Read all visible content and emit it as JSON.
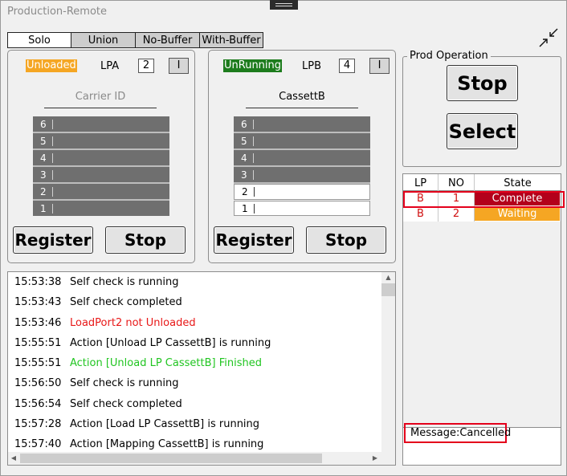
{
  "window": {
    "title": "Production-Remote"
  },
  "tabs": [
    "Solo",
    "Union",
    "No-Buffer",
    "With-Buffer"
  ],
  "icons": {
    "collapse": "collapse-arrows-icon"
  },
  "loadports": [
    {
      "status": "Unloaded",
      "status_color": "#f5a623",
      "name": "LPA",
      "count": "2",
      "i_label": "I",
      "carrier_label": "Carrier ID",
      "slots": [
        {
          "num": "6",
          "state": "dark"
        },
        {
          "num": "5",
          "state": "dark"
        },
        {
          "num": "4",
          "state": "dark"
        },
        {
          "num": "3",
          "state": "dark"
        },
        {
          "num": "2",
          "state": "dark"
        },
        {
          "num": "1",
          "state": "dark"
        }
      ],
      "register_label": "Register",
      "stop_label": "Stop"
    },
    {
      "status": "UnRunning",
      "status_color": "#1d7c1d",
      "name": "LPB",
      "count": "4",
      "i_label": "I",
      "carrier_label": "CassettB",
      "slots": [
        {
          "num": "6",
          "state": "dark"
        },
        {
          "num": "5",
          "state": "dark"
        },
        {
          "num": "4",
          "state": "dark"
        },
        {
          "num": "3",
          "state": "dark"
        },
        {
          "num": "2",
          "state": "light"
        },
        {
          "num": "1",
          "state": "light"
        }
      ],
      "register_label": "Register",
      "stop_label": "Stop"
    }
  ],
  "log": [
    {
      "time": "15:53:38",
      "msg": "Self check is running",
      "color": "black"
    },
    {
      "time": "15:53:43",
      "msg": "Self check completed",
      "color": "black"
    },
    {
      "time": "15:53:46",
      "msg": "LoadPort2 not Unloaded",
      "color": "red"
    },
    {
      "time": "15:55:51",
      "msg": "Action [Unload LP CassettB] is running",
      "color": "black"
    },
    {
      "time": "15:55:51",
      "msg": "Action [Unload LP CassettB] Finished",
      "color": "green"
    },
    {
      "time": "15:56:50",
      "msg": "Self check is running",
      "color": "black"
    },
    {
      "time": "15:56:54",
      "msg": "Self check completed",
      "color": "black"
    },
    {
      "time": "15:57:28",
      "msg": "Action [Load LP CassettB] is running",
      "color": "black"
    },
    {
      "time": "15:57:40",
      "msg": "Action [Mapping CassettB] is running",
      "color": "black"
    }
  ],
  "prod_operation": {
    "legend": "Prod Operation",
    "stop_label": "Stop",
    "select_label": "Select"
  },
  "job_table": {
    "headers": [
      "LP",
      "NO",
      "State"
    ],
    "rows": [
      {
        "lp": "B",
        "no": "1",
        "state": "Complete",
        "state_color": "#b3001b"
      },
      {
        "lp": "B",
        "no": "2",
        "state": "Waiting",
        "state_color": "#f5a623"
      }
    ]
  },
  "message": "Message:Cancelled"
}
